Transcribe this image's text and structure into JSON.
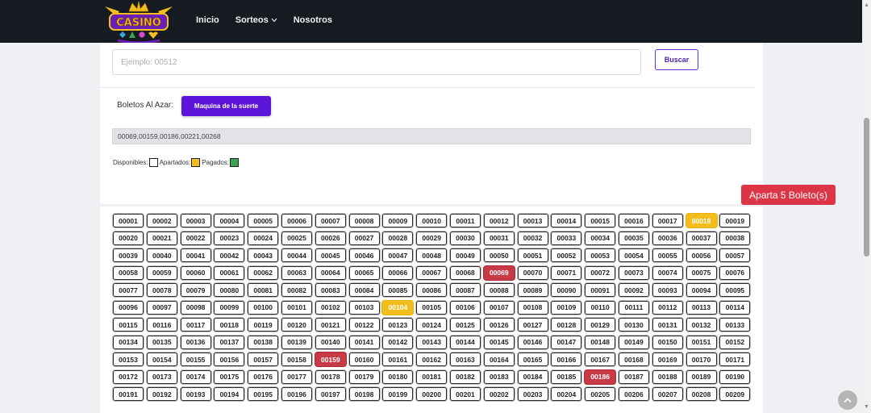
{
  "brand": {
    "name": "CASINO",
    "colors": {
      "purple": "#6a1fb8",
      "gold": "#f2bd1d"
    }
  },
  "nav": {
    "items": [
      {
        "label": "Inicio",
        "has_dropdown": false
      },
      {
        "label": "Sorteos",
        "has_dropdown": true
      },
      {
        "label": "Nosotros",
        "has_dropdown": false
      }
    ],
    "dropdown_icon": "chevron-down-icon"
  },
  "search": {
    "placeholder": "Ejemplo: 00512",
    "value": "",
    "button_label": "Buscar"
  },
  "random": {
    "label": "Boletos Al Azar:",
    "button_label": "Maquina de la suerte"
  },
  "selected_tickets": "00069,00159,00186,00221,00268",
  "legend": {
    "available": "Disponibles:",
    "reserved": "Apartados:",
    "paid": "Pagados:",
    "colors": {
      "available": "#ffffff",
      "reserved": "#f2bd1d",
      "paid": "#3aa350"
    }
  },
  "reserve_button_label": "Aparta 5 Boleto(s)",
  "tickets": {
    "first": 1,
    "last": 209,
    "digits": 5,
    "reserved": [
      "00018",
      "00104"
    ],
    "selected": [
      "00069",
      "00159",
      "00186"
    ],
    "colors": {
      "reserved": "#f2bd1d",
      "selected": "#c63b45"
    }
  },
  "scroll_to_top_icon": "chevron-up-icon"
}
